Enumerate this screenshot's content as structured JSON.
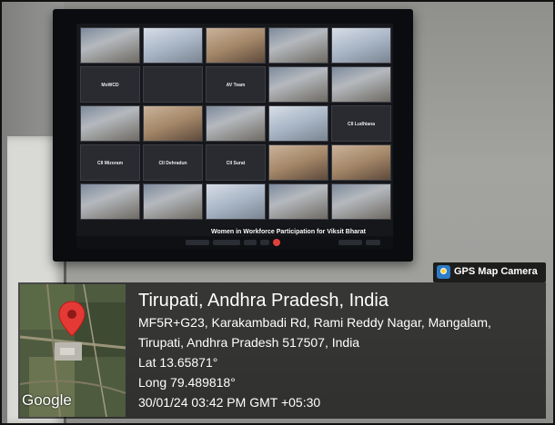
{
  "photo": {
    "description_tags": [
      "video-conference-wall-display",
      "gps-map-camera-overlay"
    ]
  },
  "screen": {
    "tiles": [
      {
        "label": "",
        "center": "",
        "kind": "video"
      },
      {
        "label": "",
        "center": "",
        "kind": "bright"
      },
      {
        "label": "",
        "center": "",
        "kind": "warm"
      },
      {
        "label": "",
        "center": "",
        "kind": "video"
      },
      {
        "label": "",
        "center": "",
        "kind": "bright"
      },
      {
        "label": "",
        "center": "MoWCD",
        "kind": "empty"
      },
      {
        "label": "",
        "center": "",
        "kind": "empty"
      },
      {
        "label": "",
        "center": "AV Team",
        "kind": "empty"
      },
      {
        "label": "",
        "center": "",
        "kind": "video"
      },
      {
        "label": "",
        "center": "",
        "kind": "video"
      },
      {
        "label": "",
        "center": "",
        "kind": "video"
      },
      {
        "label": "",
        "center": "",
        "kind": "warm"
      },
      {
        "label": "",
        "center": "",
        "kind": "video"
      },
      {
        "label": "",
        "center": "",
        "kind": "bright"
      },
      {
        "label": "",
        "center": "CII Ludhiana",
        "kind": "empty"
      },
      {
        "label": "",
        "center": "CII Mizoram",
        "kind": "empty"
      },
      {
        "label": "",
        "center": "CII Dehradun",
        "kind": "empty"
      },
      {
        "label": "",
        "center": "CII Surat",
        "kind": "empty"
      },
      {
        "label": "",
        "center": "",
        "kind": "warm"
      },
      {
        "label": "",
        "center": "",
        "kind": "warm"
      },
      {
        "label": "",
        "center": "",
        "kind": "video"
      },
      {
        "label": "",
        "center": "",
        "kind": "video"
      },
      {
        "label": "",
        "center": "",
        "kind": "bright"
      },
      {
        "label": "",
        "center": "",
        "kind": "video"
      },
      {
        "label": "",
        "center": "",
        "kind": "video"
      }
    ],
    "banner": "Women in Workforce Participation for Viksit Bharat"
  },
  "badge": {
    "label": "GPS Map Camera",
    "icon": "gps-map-camera-icon"
  },
  "location": {
    "title": "Tirupati, Andhra Pradesh, India",
    "address_line1": "MF5R+G23, Karakambadi Rd, Rami Reddy Nagar, Mangalam,",
    "address_line2": "Tirupati, Andhra Pradesh 517507, India",
    "lat": "Lat 13.65871°",
    "long": "Long 79.489818°",
    "datetime": "30/01/24 03:42 PM GMT +05:30"
  },
  "map": {
    "provider_label": "Google",
    "pin_icon": "map-pin-icon",
    "pin_color": "#e53935"
  }
}
